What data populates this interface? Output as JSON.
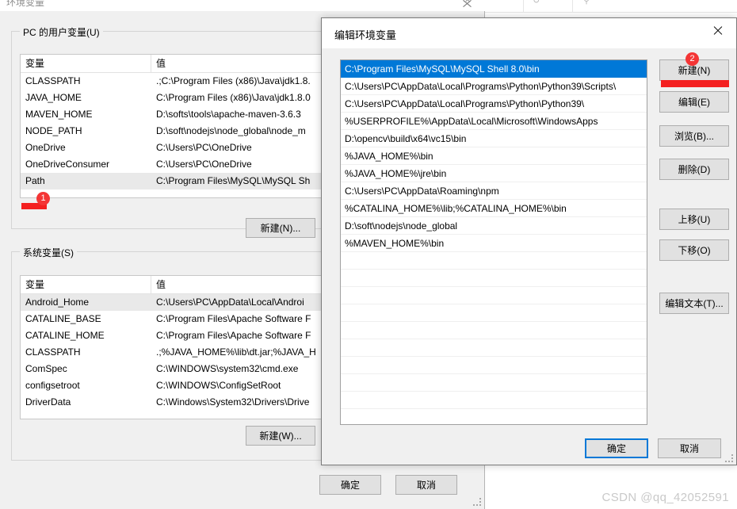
{
  "background_window": {
    "title": "环境变量",
    "user_section": {
      "legend": "PC 的用户变量(U)",
      "headers": {
        "variable": "变量",
        "value": "值"
      },
      "rows": [
        {
          "variable": "CLASSPATH",
          "value": ".;C:\\Program Files (x86)\\Java\\jdk1.8.",
          "selected": false
        },
        {
          "variable": "JAVA_HOME",
          "value": "C:\\Program Files (x86)\\Java\\jdk1.8.0",
          "selected": false
        },
        {
          "variable": "MAVEN_HOME",
          "value": "D:\\softs\\tools\\apache-maven-3.6.3",
          "selected": false
        },
        {
          "variable": "NODE_PATH",
          "value": "D:\\soft\\nodejs\\node_global\\node_m",
          "selected": false
        },
        {
          "variable": "OneDrive",
          "value": "C:\\Users\\PC\\OneDrive",
          "selected": false
        },
        {
          "variable": "OneDriveConsumer",
          "value": "C:\\Users\\PC\\OneDrive",
          "selected": false
        },
        {
          "variable": "Path",
          "value": "C:\\Program Files\\MySQL\\MySQL Sh",
          "selected": true
        }
      ],
      "new_button": "新建(N)..."
    },
    "system_section": {
      "legend": "系统变量(S)",
      "headers": {
        "variable": "变量",
        "value": "值"
      },
      "rows": [
        {
          "variable": "Android_Home",
          "value": "C:\\Users\\PC\\AppData\\Local\\Androi",
          "selected": true
        },
        {
          "variable": "CATALINE_BASE",
          "value": "C:\\Program Files\\Apache Software F",
          "selected": false
        },
        {
          "variable": "CATALINE_HOME",
          "value": "C:\\Program Files\\Apache Software F",
          "selected": false
        },
        {
          "variable": "CLASSPATH",
          "value": ".;%JAVA_HOME%\\lib\\dt.jar;%JAVA_H",
          "selected": false
        },
        {
          "variable": "ComSpec",
          "value": "C:\\WINDOWS\\system32\\cmd.exe",
          "selected": false
        },
        {
          "variable": "configsetroot",
          "value": "C:\\WINDOWS\\ConfigSetRoot",
          "selected": false
        },
        {
          "variable": "DriverData",
          "value": "C:\\Windows\\System32\\Drivers\\Drive",
          "selected": false
        }
      ],
      "new_button": "新建(W)..."
    },
    "footer": {
      "ok": "确定",
      "cancel": "取消"
    }
  },
  "modal": {
    "title": "编辑环境变量",
    "close_icon": "close-icon",
    "path_entries": [
      {
        "text": "C:\\Program Files\\MySQL\\MySQL Shell 8.0\\bin",
        "selected": true
      },
      {
        "text": "C:\\Users\\PC\\AppData\\Local\\Programs\\Python\\Python39\\Scripts\\",
        "selected": false
      },
      {
        "text": "C:\\Users\\PC\\AppData\\Local\\Programs\\Python\\Python39\\",
        "selected": false
      },
      {
        "text": "%USERPROFILE%\\AppData\\Local\\Microsoft\\WindowsApps",
        "selected": false
      },
      {
        "text": "D:\\opencv\\build\\x64\\vc15\\bin",
        "selected": false
      },
      {
        "text": "%JAVA_HOME%\\bin",
        "selected": false
      },
      {
        "text": "%JAVA_HOME%\\jre\\bin",
        "selected": false
      },
      {
        "text": "C:\\Users\\PC\\AppData\\Roaming\\npm",
        "selected": false
      },
      {
        "text": "%CATALINA_HOME%\\lib;%CATALINA_HOME%\\bin",
        "selected": false
      },
      {
        "text": "D:\\soft\\nodejs\\node_global",
        "selected": false
      },
      {
        "text": "%MAVEN_HOME%\\bin",
        "selected": false
      }
    ],
    "empty_row_count": 10,
    "buttons": {
      "new": "新建(N)",
      "edit": "编辑(E)",
      "browse": "浏览(B)...",
      "delete": "删除(D)",
      "move_up": "上移(U)",
      "move_down": "下移(O)",
      "edit_text": "编辑文本(T)..."
    },
    "footer": {
      "ok": "确定",
      "cancel": "取消"
    }
  },
  "annotations": {
    "badge_1": "1",
    "badge_2": "2",
    "marker_color": "#f43535",
    "bar_color": "#f42020"
  },
  "watermark": "CSDN @qq_42052591",
  "colors": {
    "selection_blue": "#0078d7",
    "window_face": "#f0f0f0",
    "button_face": "#e1e1e1"
  }
}
